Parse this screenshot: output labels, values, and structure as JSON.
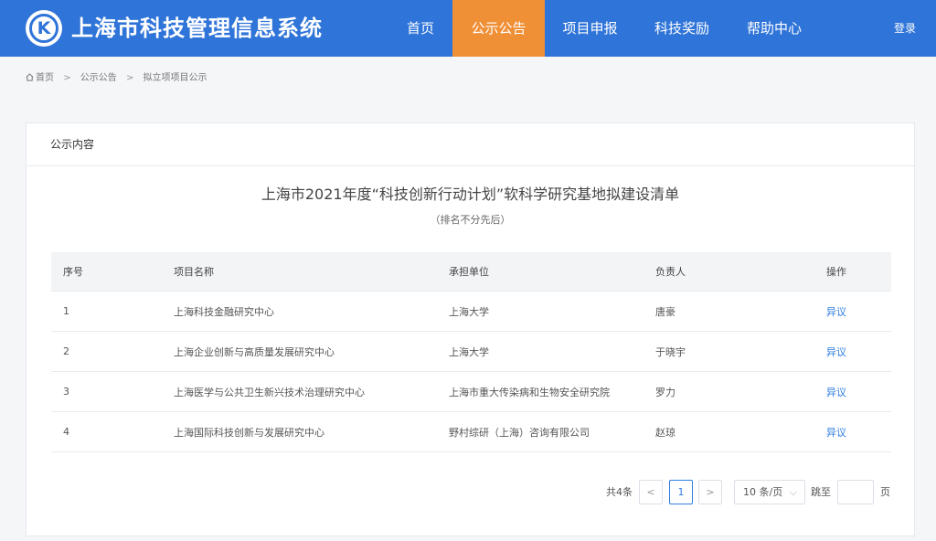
{
  "header": {
    "logo_letter": "K",
    "brand": "上海市科技管理信息系统",
    "nav": [
      "首页",
      "公示公告",
      "项目申报",
      "科技奖励",
      "帮助中心"
    ],
    "active_nav": "公示公告",
    "login": "登录",
    "accent_color": "#2f74d8",
    "active_color": "#ef8f36"
  },
  "breadcrumb": {
    "icon": "home-icon",
    "items": [
      "首页",
      "公示公告",
      "拟立项项目公示"
    ],
    "separator": ">"
  },
  "card": {
    "title": "公示内容",
    "doc_title": "上海市2021年度“科技创新行动计划”软科学研究基地拟建设清单",
    "doc_subtitle": "（排名不分先后）"
  },
  "table": {
    "headers": [
      "序号",
      "项目名称",
      "承担单位",
      "负责人",
      "操作"
    ],
    "rows": [
      [
        "1",
        "上海科技金融研究中心",
        "上海大学",
        "唐豪",
        "异议"
      ],
      [
        "2",
        "上海企业创新与高质量发展研究中心",
        "上海大学",
        "于晓宇",
        "异议"
      ],
      [
        "3",
        "上海医学与公共卫生新兴技术治理研究中心",
        "上海市重大传染病和生物安全研究院",
        "罗力",
        "异议"
      ],
      [
        "4",
        "上海国际科技创新与发展研究中心",
        "野村综研（上海）咨询有限公司",
        "赵琼",
        "异议"
      ]
    ]
  },
  "pagination": {
    "total": "共4条",
    "prev": "<",
    "current": "1",
    "next": ">",
    "page_size": "10 条/页",
    "jump_label": "跳至",
    "jump_value": "",
    "page_suffix": "页"
  }
}
